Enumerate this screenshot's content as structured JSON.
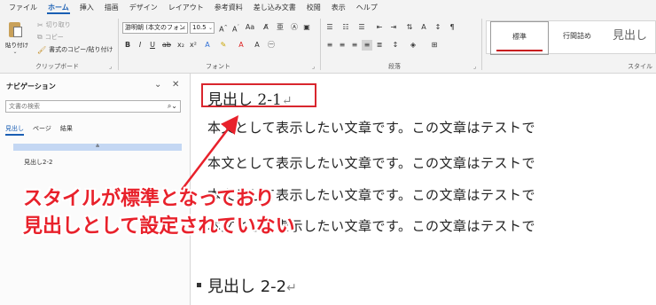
{
  "menu": {
    "tabs": [
      "ファイル",
      "ホーム",
      "挿入",
      "描画",
      "デザイン",
      "レイアウト",
      "参考資料",
      "差し込み文書",
      "校閲",
      "表示",
      "ヘルプ"
    ],
    "active": "ホーム"
  },
  "ribbon": {
    "clipboard": {
      "paste_label": "貼り付け",
      "cut_label": "切り取り",
      "copy_label": "コピー",
      "format_painter_label": "書式のコピー/貼り付け",
      "group_label": "クリップボード"
    },
    "font": {
      "font_name": "游明朝 (本文のフォン",
      "font_size": "10.5",
      "group_label": "フォント"
    },
    "paragraph": {
      "group_label": "段落"
    },
    "styles": {
      "items": [
        "標準",
        "行間詰め",
        "見出し"
      ],
      "selected": "標準",
      "group_label": "スタイル"
    }
  },
  "nav_pane": {
    "title": "ナビゲーション",
    "search_placeholder": "文書の検索",
    "tabs": [
      "見出し",
      "ページ",
      "結果"
    ],
    "active_tab": "見出し",
    "headings": [
      "見出し2-2"
    ]
  },
  "document": {
    "heading1": "見出し 2-1",
    "paragraphs": [
      "本文として表示したい文章です。この文章はテストで",
      "本文として表示したい文章です。この文章はテストで",
      "本文として表示したい文章です。この文章はテストで",
      "本文として表示したい文章です。この文章はテストで"
    ],
    "heading2": "見出し 2-2"
  },
  "annotation": {
    "line1": "スタイルが標準となっており",
    "line2": "見出しとして設定されていない",
    "color": "#e8212b"
  }
}
